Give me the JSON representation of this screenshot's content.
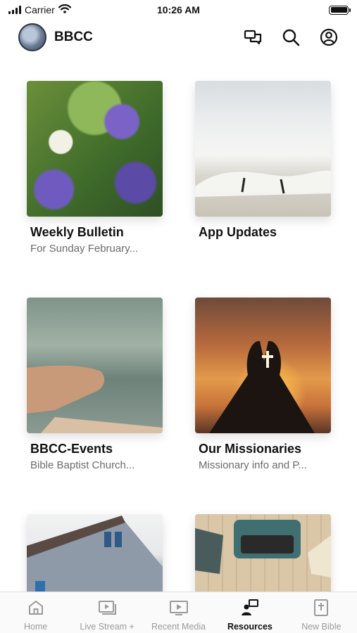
{
  "status": {
    "carrier": "Carrier",
    "time": "10:26 AM"
  },
  "header": {
    "title": "BBCC"
  },
  "cards": [
    {
      "title": "Weekly Bulletin",
      "subtitle": "For Sunday February..."
    },
    {
      "title": "App Updates",
      "subtitle": ""
    },
    {
      "title": "BBCC-Events",
      "subtitle": "Bible Baptist Church..."
    },
    {
      "title": "Our Missionaries",
      "subtitle": "Missionary info and P..."
    },
    {
      "title": "",
      "subtitle": ""
    },
    {
      "title": "",
      "subtitle": ""
    }
  ],
  "nav": [
    {
      "label": "Home",
      "icon": "home-icon"
    },
    {
      "label": "Live Stream +",
      "icon": "live-stream-icon"
    },
    {
      "label": "Recent Media",
      "icon": "media-play-icon"
    },
    {
      "label": "Resources",
      "icon": "resources-icon",
      "active": true
    },
    {
      "label": "New Bible",
      "icon": "bible-icon"
    }
  ],
  "colors": {
    "active": "#111111",
    "inactive": "#9a9a9a"
  }
}
